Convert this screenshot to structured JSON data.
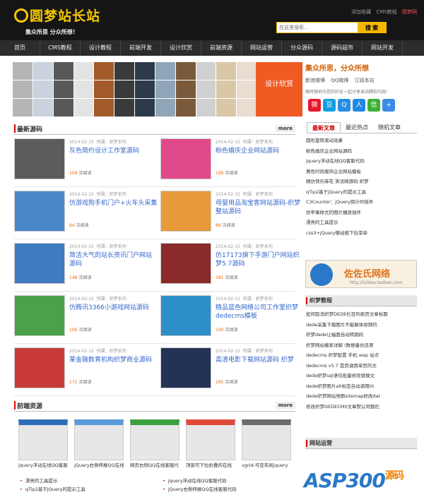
{
  "header": {
    "logo": "圆梦站长站",
    "slogan": "集众所思  分众所想！",
    "toplinks": [
      "添加收藏",
      "CMS教程",
      "圆梦网"
    ],
    "search_placeholder": "在这里搜索...",
    "search_button": "搜 索"
  },
  "nav": [
    "首页",
    "CMS教程",
    "设计教程",
    "前端开发",
    "设计欣赏",
    "前端资源",
    "网站运营",
    "分众源码",
    "源码超市",
    "网站开发"
  ],
  "banner": {
    "design_label": "设计欣赏",
    "tagline": "集众所思，分众所想",
    "links": [
      "新浪微博",
      "QQ微博",
      "订阅本站"
    ],
    "desc": "随时随地与您的好友一起分享本站精彩内容!"
  },
  "share_icons": [
    "sina-weibo",
    "douban",
    "qq-zone",
    "renren",
    "wechat",
    "more"
  ],
  "latest": {
    "title": "最新源码",
    "more": "more",
    "items": [
      {
        "date": "2014-02-15",
        "cat_label": "所属：",
        "cat": "织梦系列",
        "title": "灰色简约设计工作室源码",
        "views": "109",
        "views_label": "次阅读"
      },
      {
        "date": "2014-02-15",
        "cat_label": "所属：",
        "cat": "织梦系列",
        "title": "粉色婚庆企业网站源码",
        "views": "199",
        "views_label": "次阅读"
      },
      {
        "date": "2014-02-15",
        "cat_label": "所属：",
        "cat": "织梦系列",
        "title": "仿游戏狗手机门户+火车头采集",
        "views": "94",
        "views_label": "次阅读"
      },
      {
        "date": "2014-02-15",
        "cat_label": "所属：",
        "cat": "织梦系列",
        "title": "母婴用品淘宝客网站源码-织梦整站源码",
        "views": "89",
        "views_label": "次阅读"
      },
      {
        "date": "2014-02-15",
        "cat_label": "所属：",
        "cat": "织梦系列",
        "title": "简洁大气的站长资讯门户网站源码",
        "views": "148",
        "views_label": "次阅读"
      },
      {
        "date": "2014-02-15",
        "cat_label": "所属：",
        "cat": "织梦系列",
        "title": "仿17173旗下手游门户网站织梦5.7源码",
        "views": "181",
        "views_label": "次阅读"
      },
      {
        "date": "2014-02-15",
        "cat_label": "所属：",
        "cat": "织梦系列",
        "title": "仿腾讯3366小游戏网站源码",
        "views": "106",
        "views_label": "次阅读"
      },
      {
        "date": "2014-02-15",
        "cat_label": "所属：",
        "cat": "织梦系列",
        "title": "精品蓝色网络公司工作室织梦dedecms模板",
        "views": "140",
        "views_label": "次阅读"
      },
      {
        "date": "2014-02-15",
        "cat_label": "所属：",
        "cat": "织梦系列",
        "title": "某金融数育机构织梦商业源码",
        "views": "171",
        "views_label": "次阅读"
      },
      {
        "date": "2014-02-15",
        "cat_label": "所属：",
        "cat": "织梦系列",
        "title": "高清电影下载网站源码 织梦",
        "views": "195",
        "views_label": "次阅读"
      }
    ]
  },
  "sidebar": {
    "tabs": [
      "最新文章",
      "最近热点",
      "随机文章"
    ],
    "articles": [
      "圆形旋转滚动效果",
      "粉色婚庆企业网站源码",
      "jquery浮动在线QQ客服代码",
      "黄色时尚服饰企业网站模板",
      "精仿快乐麻花 笑话网源码 织梦",
      "qTip2基于jQuery的提示工具",
      "C3Counter：jQuery倒计时插件",
      "仿苹果样式的图片播放插件",
      "漂亮的工具提示",
      "css3+jQuery懒动感下拉菜单"
    ],
    "ad_name": "佐佐氏网络",
    "ad_url": "http://luidea.taobao.com",
    "dede_title": "织梦教程",
    "dede": [
      "如何取消织梦DEDE栏目列表页文章标题",
      "dede采集下载图片不能解体视频的",
      "织梦dede让幅面自动转跳码",
      "织梦网站搬家详解 (数据备份还原",
      "dedecms 织梦配置 手机 wap 站点",
      "dedecms v5.7 首页调用单页的文",
      "dede织梦sql语句批量修改替换文",
      "dede织梦图片alt标签自动调用tit",
      "dede织梦网站地图sitemap修改dat",
      "修改织梦DEDECMS文章默认阿题栏"
    ],
    "ops_title": "网站运营"
  },
  "frontend": {
    "title": "前端资源",
    "more": "more",
    "items": [
      "jquery浮动在线QQ客服",
      "jQuery右侧伸展QQ在线",
      "网页右侧QQ在线客服代",
      "顶部可下拉折叠的在线",
      "vgrid-可变布局jquery"
    ],
    "list_left": [
      "漂亮的工具提示",
      "qTip2基于jQuery的提示工具"
    ],
    "list_right": [
      "jquery浮动在线QQ客服代码",
      "jQuery右侧伸展QQ在线客服代码"
    ]
  },
  "watermark": {
    "text": "ASP300",
    "sub": "源码"
  }
}
